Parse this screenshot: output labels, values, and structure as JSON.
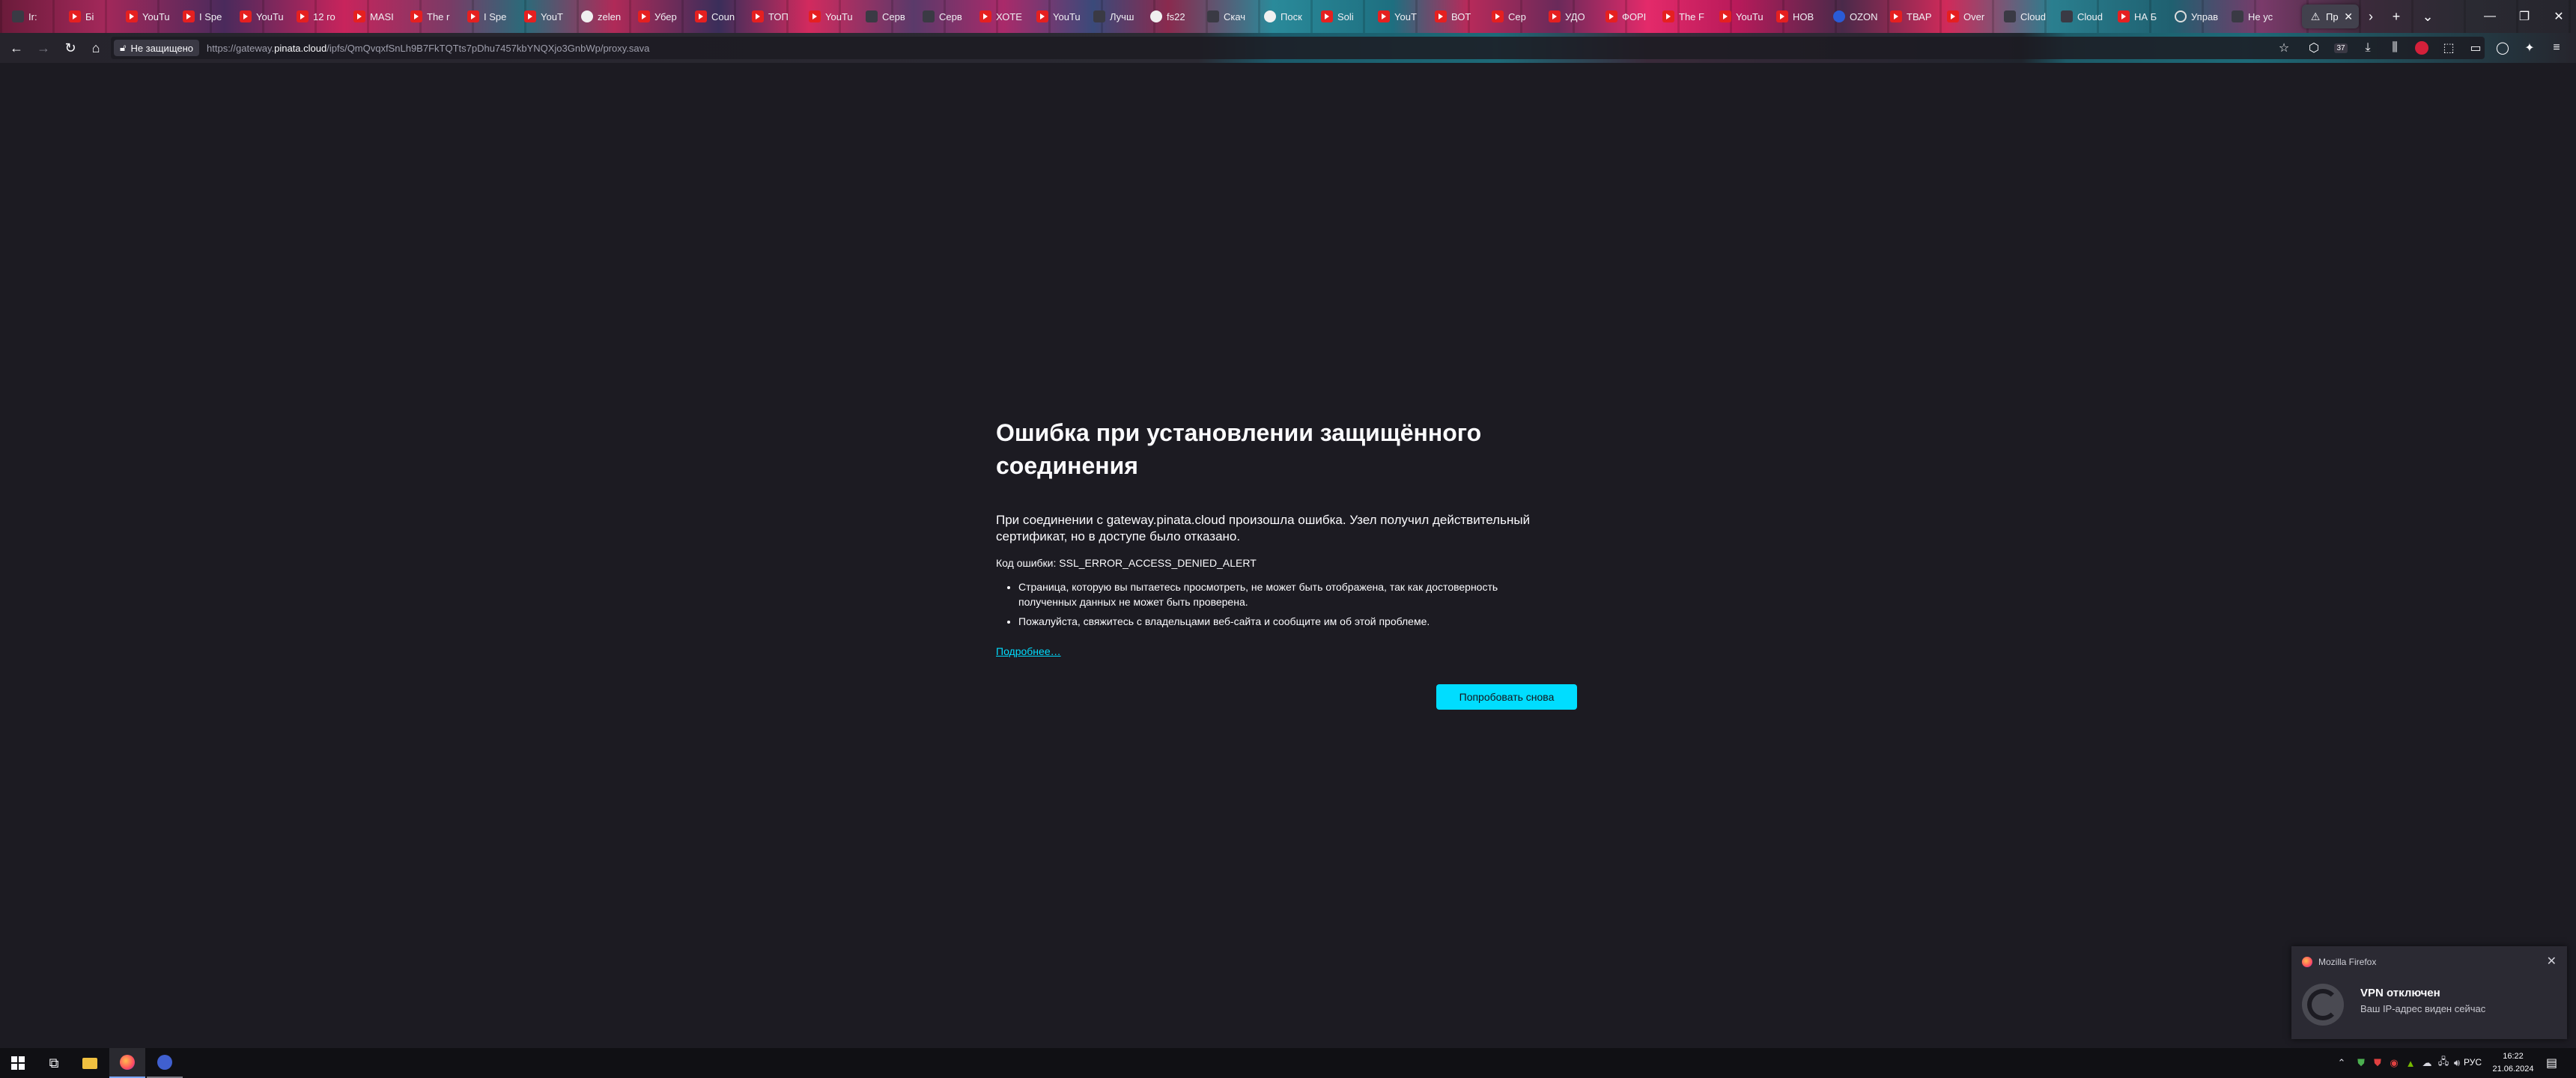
{
  "tabs": [
    {
      "label": "Ir:",
      "icon": "gen"
    },
    {
      "label": "Бi",
      "icon": "yt"
    },
    {
      "label": "YouTu",
      "icon": "yt"
    },
    {
      "label": "I Spe",
      "icon": "yt"
    },
    {
      "label": "YouTu",
      "icon": "yt"
    },
    {
      "label": "12 го",
      "icon": "yt"
    },
    {
      "label": "MASI",
      "icon": "yt"
    },
    {
      "label": "The r",
      "icon": "yt"
    },
    {
      "label": "I Spe",
      "icon": "yt"
    },
    {
      "label": "YouT",
      "icon": "yt"
    },
    {
      "label": "zelen",
      "icon": "gh"
    },
    {
      "label": "Убер",
      "icon": "yt"
    },
    {
      "label": "Coun",
      "icon": "yt"
    },
    {
      "label": "ТОП",
      "icon": "yt"
    },
    {
      "label": "YouTu",
      "icon": "yt"
    },
    {
      "label": "Серв",
      "icon": "gen"
    },
    {
      "label": "Серв",
      "icon": "gen"
    },
    {
      "label": "ХОТЕ",
      "icon": "yt"
    },
    {
      "label": "YouTu",
      "icon": "yt"
    },
    {
      "label": "Лучш",
      "icon": "gen"
    },
    {
      "label": "fs22",
      "icon": "gh"
    },
    {
      "label": "Скач",
      "icon": "gen"
    },
    {
      "label": "Поск",
      "icon": "gh"
    },
    {
      "label": "Soli",
      "icon": "yt"
    },
    {
      "label": "YouT",
      "icon": "yt"
    },
    {
      "label": "ВОТ",
      "icon": "yt"
    },
    {
      "label": "Сер",
      "icon": "yt"
    },
    {
      "label": "УДО",
      "icon": "yt"
    },
    {
      "label": "ФОРI",
      "icon": "yt"
    },
    {
      "label": "The F",
      "icon": "yt"
    },
    {
      "label": "YouTu",
      "icon": "yt"
    },
    {
      "label": "НОВ",
      "icon": "yt"
    },
    {
      "label": "OZON",
      "icon": "oz"
    },
    {
      "label": "ТВАР",
      "icon": "yt"
    },
    {
      "label": "Over",
      "icon": "yt"
    },
    {
      "label": "Cloud",
      "icon": "gen"
    },
    {
      "label": "Cloud",
      "icon": "gen"
    },
    {
      "label": "НА Б",
      "icon": "yt"
    },
    {
      "label": "Управ",
      "icon": "wa"
    },
    {
      "label": "Не ус",
      "icon": "gen"
    }
  ],
  "active_tab": {
    "label": "Пр"
  },
  "url": {
    "security_label": "Не защищено",
    "prefix": "https://gateway.",
    "host": "pinata.cloud",
    "path": "/ipfs/QmQvqxfSnLh9B7FkTQTts7pDhu7457kbYNQXjo3GnbWp/proxy.sava"
  },
  "error": {
    "title": "Ошибка при установлении защищённого соединения",
    "intro": "При соединении с gateway.pinata.cloud произошла ошибка. Узел получил действительный сертификат, но в доступе было отказано.",
    "code": "Код ошибки: SSL_ERROR_ACCESS_DENIED_ALERT",
    "bullets": [
      "Страница, которую вы пытаетесь просмотреть, не может быть отображена, так как достоверность полученных данных не может быть проверена.",
      "Пожалуйста, свяжитесь с владельцами веб-сайта и сообщите им об этой проблеме."
    ],
    "learn_more": "Подробнее…",
    "retry": "Попробовать снова"
  },
  "notification": {
    "app": "Mozilla Firefox",
    "title": "VPN отключен",
    "body": "Ваш IP-адрес виден сейчас"
  },
  "toolbar": {
    "addon_badge": "37"
  },
  "taskbar": {
    "lang": "РУС",
    "time": "16:22",
    "date": "21.06.2024"
  },
  "colors": {
    "page_bg": "#1c1b22",
    "accent": "#00ddff",
    "text": "#fbfbfe"
  }
}
